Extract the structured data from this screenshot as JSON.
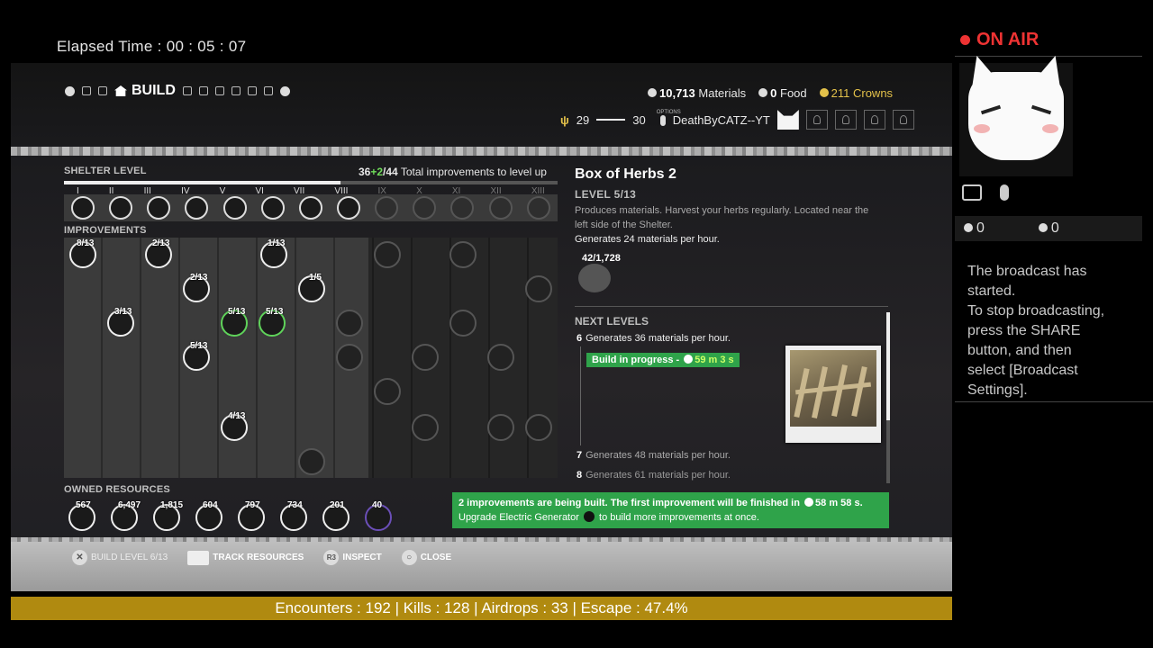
{
  "stream": {
    "elapsed_label": "Elapsed Time :",
    "elapsed_value": "00 : 05 : 07",
    "on_air": "ON AIR",
    "viewers": "0",
    "comments": "0",
    "message": "The broadcast has started.\nTo stop broadcasting, press the SHARE button, and then select [Broadcast Settings].",
    "stats": "Encounters : 192 | Kills : 128 | Airdrops : 33 | Escape : 47.4%"
  },
  "nav": {
    "active_tab": "BUILD"
  },
  "resources": {
    "materials_value": "10,713",
    "materials_label": "Materials",
    "food_value": "0",
    "food_label": "Food",
    "crowns": "211 Crowns"
  },
  "player": {
    "stat_low": "29",
    "stat_high": "30",
    "options_label": "OPTIONS",
    "name": "DeathByCATZ--YT"
  },
  "shelter": {
    "title": "SHELTER LEVEL",
    "progress_current": "36",
    "progress_add": "+2",
    "progress_total": "/44",
    "progress_suffix": "Total improvements to level up",
    "progress_fraction": 0.56,
    "levels": [
      "I",
      "II",
      "III",
      "IV",
      "V",
      "VI",
      "VII",
      "VIII",
      "IX",
      "X",
      "XI",
      "XII",
      "XIII"
    ],
    "levels_unlocked": 8
  },
  "improvements": {
    "title": "IMPROVEMENTS",
    "nodes": [
      {
        "label": "8/13"
      },
      {
        "label": "2/13"
      },
      {
        "label": "1/13"
      },
      {
        "label": "2/13"
      },
      {
        "label": "1/5"
      },
      {
        "label": "3/13"
      },
      {
        "label": "5/13"
      },
      {
        "label": "5/13"
      },
      {
        "label": "5/13"
      },
      {
        "label": "4/13"
      }
    ]
  },
  "owned": {
    "title": "OWNED RESOURCES",
    "items": [
      {
        "value": "567"
      },
      {
        "value": "6,497"
      },
      {
        "value": "1,815"
      },
      {
        "value": "604"
      },
      {
        "value": "797"
      },
      {
        "value": "734"
      },
      {
        "value": "201"
      },
      {
        "value": "40"
      }
    ]
  },
  "detail": {
    "title": "Box of Herbs 2",
    "level": "LEVEL 5/13",
    "description": "Produces materials. Harvest your herbs regularly. Located near the left side of the Shelter.",
    "generates": "Generates 24 materials per hour.",
    "stock": "42/1,728",
    "next_title": "NEXT LEVELS",
    "next": [
      {
        "num": "6",
        "text": "Generates 36 materials per hour."
      },
      {
        "num": "7",
        "text": "Generates 48 materials per hour."
      },
      {
        "num": "8",
        "text": "Generates 61 materials per hour."
      }
    ],
    "progress_label": "Build in progress -",
    "progress_time": "59 m 3 s"
  },
  "notice": {
    "line1_a": "2 improvements are being built. The first improvement will be finished in",
    "line1_time": "58 m 58 s.",
    "line2_a": "Upgrade Electric Generator",
    "line2_b": "to build more improvements at once."
  },
  "controls": {
    "build_level": "BUILD LEVEL 6/13",
    "track": "TRACK RESOURCES",
    "r3": "R3",
    "inspect": "INSPECT",
    "close": "CLOSE"
  },
  "colors": {
    "accent_green": "#2fa34a",
    "crowns_gold": "#e3c14a",
    "on_air_red": "#e33333",
    "stats_bar": "#b08a10"
  }
}
